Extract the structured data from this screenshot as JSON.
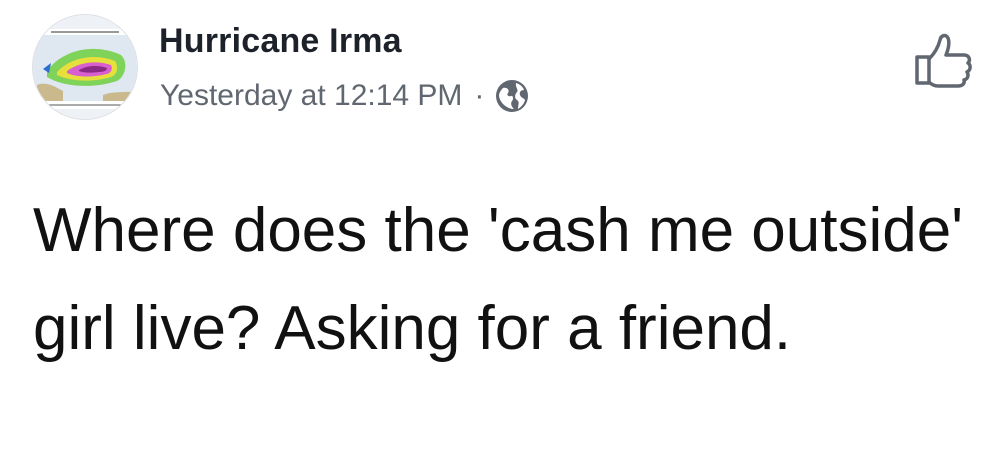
{
  "post": {
    "author": {
      "name": "Hurricane Irma",
      "avatar_icon": "hurricane-forecast-map-icon"
    },
    "timestamp": "Yesterday at 12:14 PM",
    "separator": "·",
    "privacy_icon": "globe-icon",
    "like_icon": "thumbs-up-icon",
    "text": "Where does the 'cash me outside' girl live? Asking for a friend."
  },
  "colors": {
    "name": "#1d2129",
    "meta": "#616770",
    "body_text": "#111111",
    "background": "#ffffff"
  }
}
